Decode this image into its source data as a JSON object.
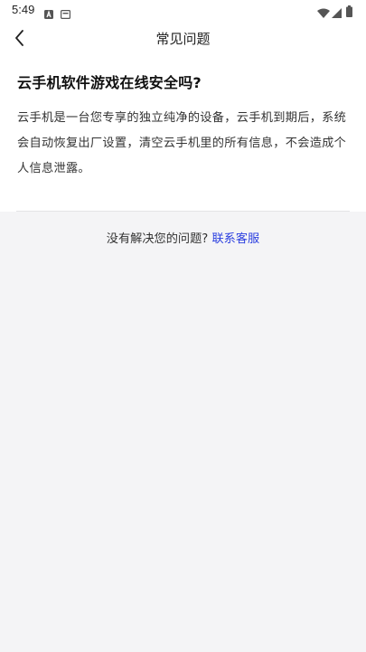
{
  "status_bar": {
    "time": "5:49",
    "left_icons": [
      "notification-a-icon",
      "cast-icon"
    ],
    "right_icons": [
      "wifi-icon",
      "signal-icon",
      "battery-icon"
    ]
  },
  "app_bar": {
    "title": "常见问题"
  },
  "faq": {
    "question": "云手机软件游戏在线安全吗?",
    "answer": "云手机是一台您专享的独立纯净的设备，云手机到期后，系统会自动恢复出厂设置，清空云手机里的所有信息，不会造成个人信息泄露。"
  },
  "footer": {
    "prompt": "没有解决您的问题?",
    "contact_link": "联系客服"
  },
  "colors": {
    "page_background": "#f4f4f6",
    "card_background": "#ffffff",
    "link": "#2b3fe0"
  }
}
